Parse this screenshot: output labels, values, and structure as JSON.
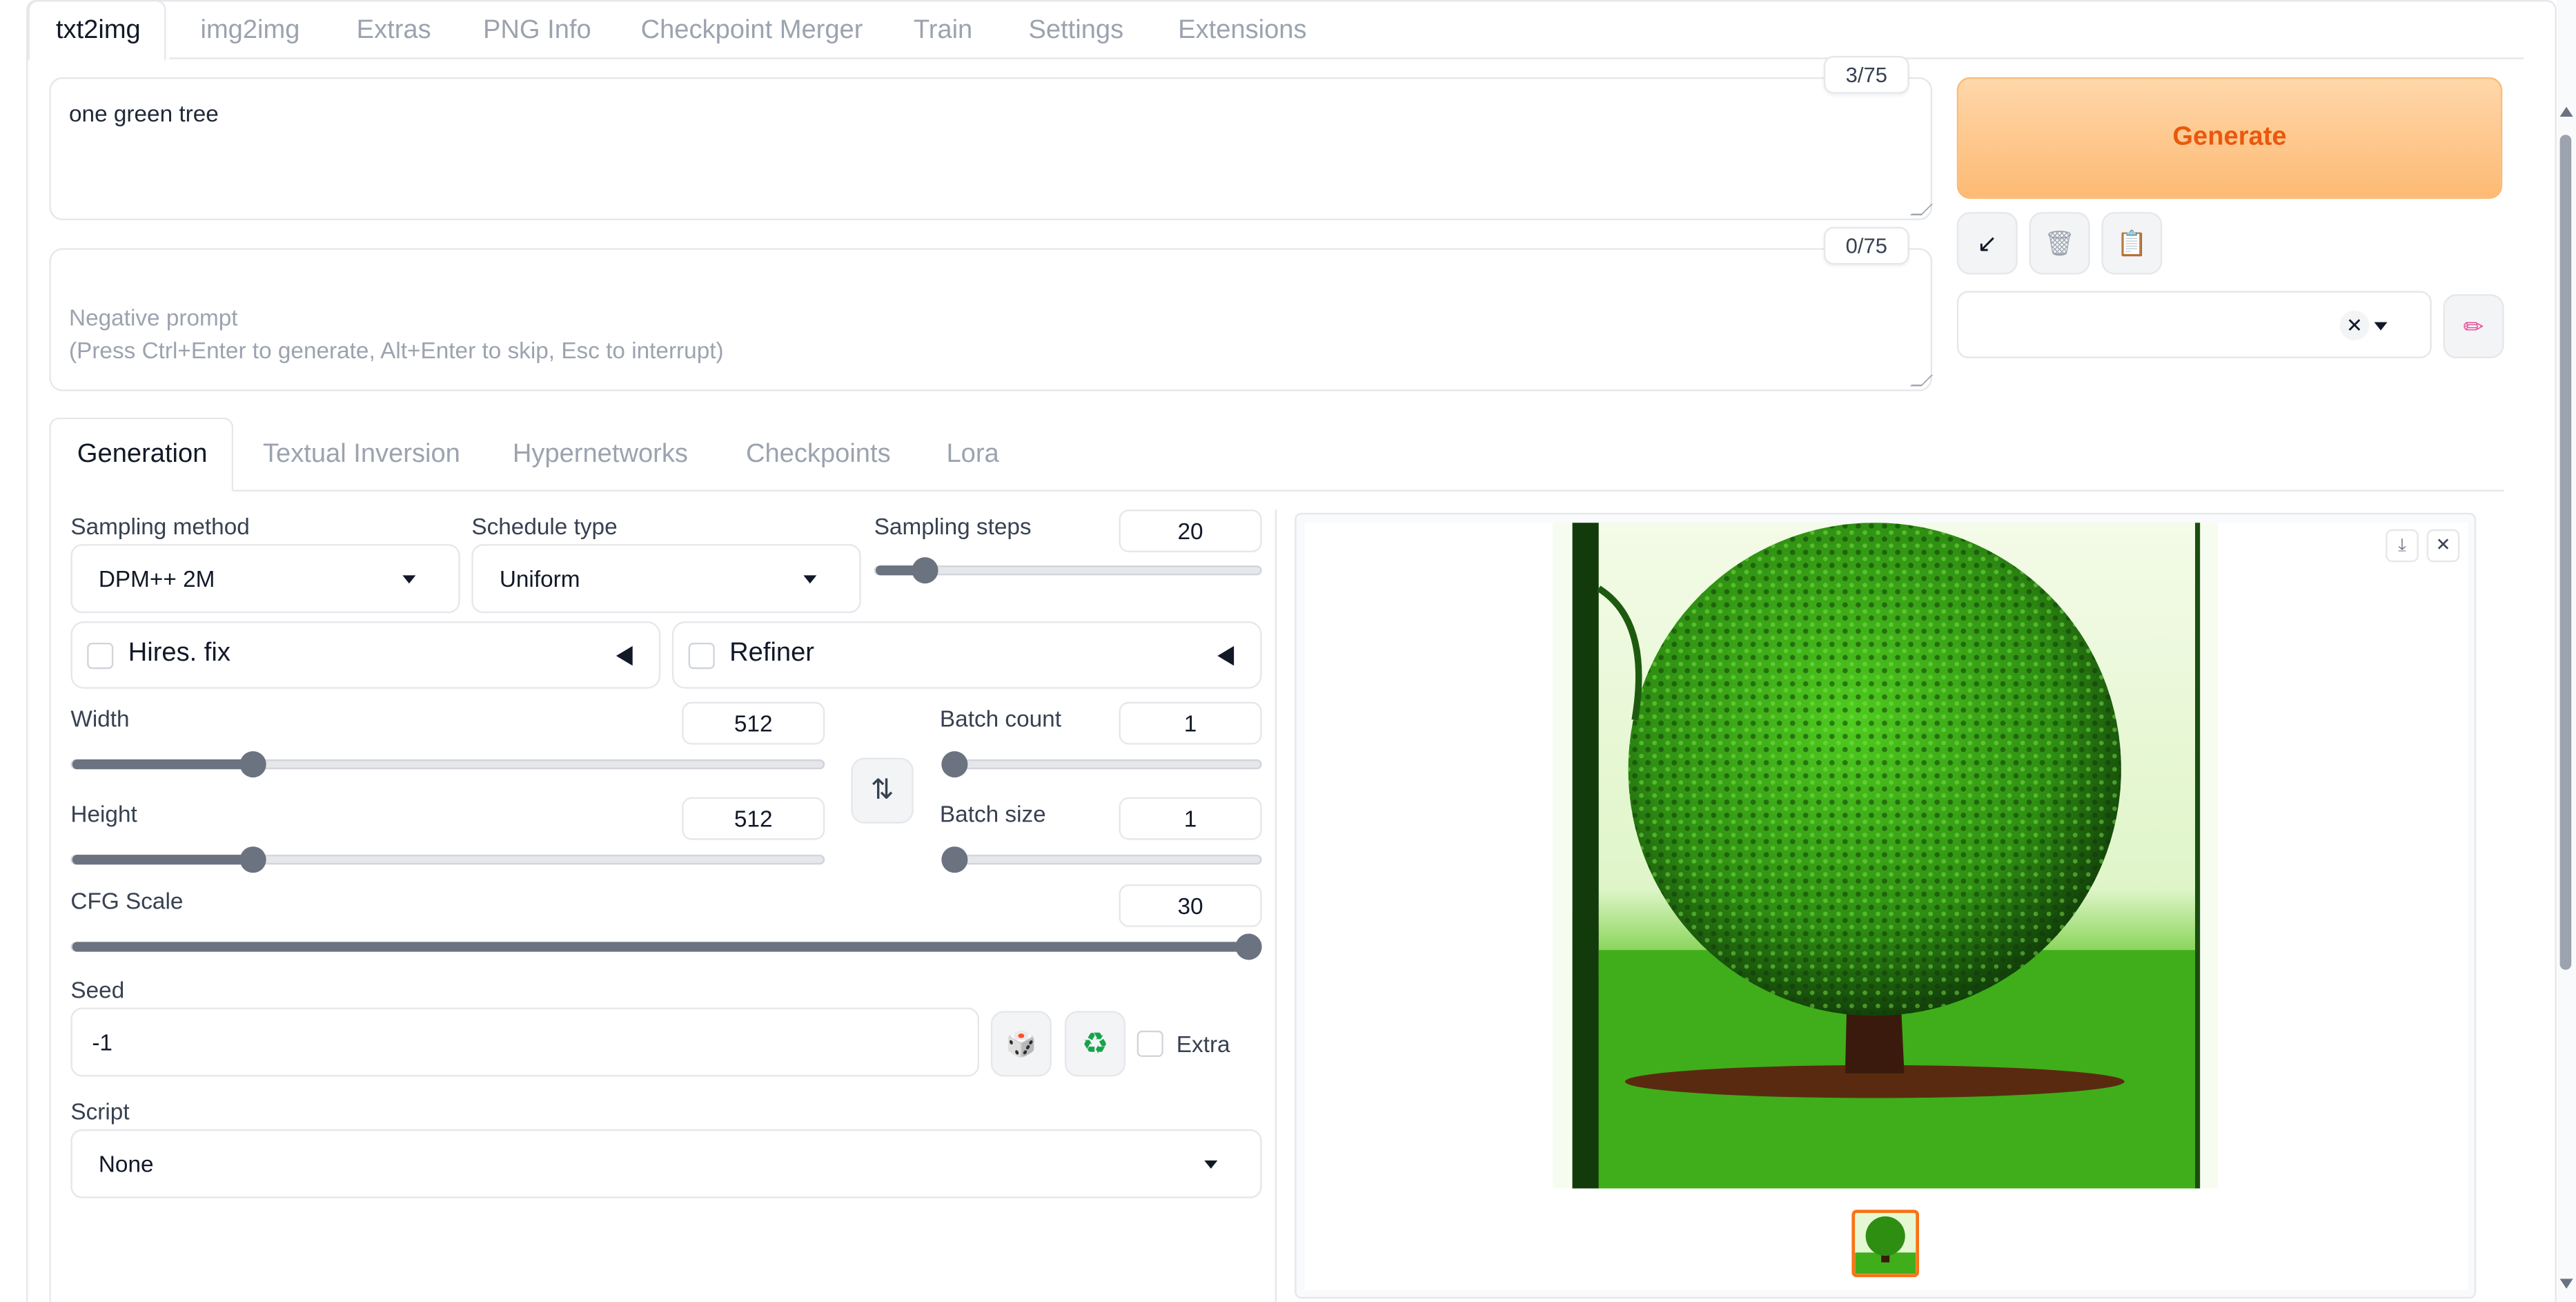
{
  "top_tabs": [
    "txt2img",
    "img2img",
    "Extras",
    "PNG Info",
    "Checkpoint Merger",
    "Train",
    "Settings",
    "Extensions"
  ],
  "prompt": {
    "value": "one green tree",
    "counter": "3/75"
  },
  "negative_prompt": {
    "placeholder": "Negative prompt\n(Press Ctrl+Enter to generate, Alt+Enter to skip, Esc to interrupt)",
    "counter": "0/75"
  },
  "generate_label": "Generate",
  "tool_icons": {
    "read": "↙",
    "trash": "🗑",
    "paste": "📋",
    "edit": "✏"
  },
  "style_clear": "✕",
  "sub_tabs": [
    "Generation",
    "Textual Inversion",
    "Hypernetworks",
    "Checkpoints",
    "Lora"
  ],
  "sampling": {
    "method_label": "Sampling method",
    "method": "DPM++ 2M",
    "schedule_label": "Schedule type",
    "schedule": "Uniform",
    "steps_label": "Sampling steps",
    "steps": "20",
    "steps_fraction": 0.13
  },
  "hires_label": "Hires. fix",
  "refiner_label": "Refiner",
  "width": {
    "label": "Width",
    "value": "512",
    "fraction": 0.24
  },
  "height": {
    "label": "Height",
    "value": "512",
    "fraction": 0.24
  },
  "swap_icon": "⇅",
  "batch_count": {
    "label": "Batch count",
    "value": "1",
    "fraction": 0.0
  },
  "batch_size": {
    "label": "Batch size",
    "value": "1",
    "fraction": 0.0
  },
  "cfg": {
    "label": "CFG Scale",
    "value": "30",
    "fraction": 1.0
  },
  "seed": {
    "label": "Seed",
    "value": "-1",
    "dice_icon": "🎲",
    "recycle_icon": "♻",
    "extra_label": "Extra"
  },
  "script": {
    "label": "Script",
    "value": "None"
  },
  "output": {
    "download_icon": "⤓",
    "close_icon": "✕"
  },
  "colors": {
    "accent": "#ea580c",
    "generate_bg": "#fdba74",
    "tree_green": "#3fae1a",
    "thumb_border": "#f97316"
  }
}
